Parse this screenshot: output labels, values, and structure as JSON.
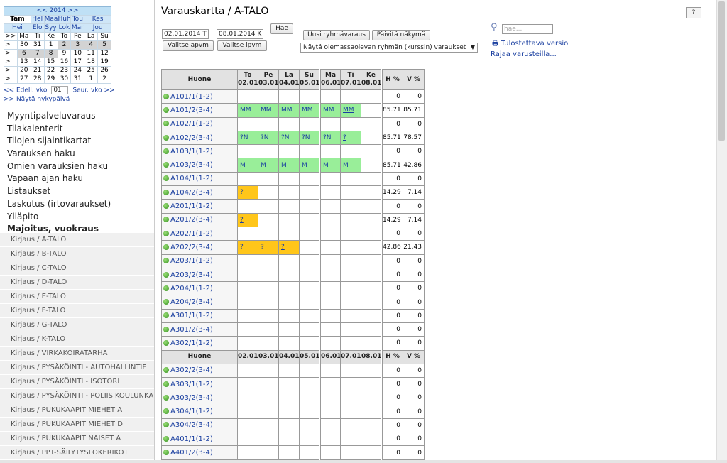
{
  "calendar": {
    "year_nav": "<< 2014 >>",
    "months_row1": [
      "Tam",
      "Hel",
      "Maa",
      "Huh",
      "Tou",
      "Kes"
    ],
    "months_row2": [
      "Hei",
      "Elo",
      "Syy",
      "Lok",
      "Mar",
      "Jou"
    ],
    "selected_month": "Tam",
    "day_header": [
      ">>",
      "Ma",
      "Ti",
      "Ke",
      "To",
      "Pe",
      "La",
      "Su"
    ],
    "weeks": [
      [
        ">",
        "30",
        "31",
        "1",
        "2",
        "3",
        "4",
        "5"
      ],
      [
        ">",
        "6",
        "7",
        "8",
        "9",
        "10",
        "11",
        "12"
      ],
      [
        ">",
        "13",
        "14",
        "15",
        "16",
        "17",
        "18",
        "19"
      ],
      [
        ">",
        "20",
        "21",
        "22",
        "23",
        "24",
        "25",
        "26"
      ],
      [
        ">",
        "27",
        "28",
        "29",
        "30",
        "31",
        "1",
        "2"
      ]
    ],
    "prev_week": "<< Edell. vko",
    "week_value": "01",
    "next_week": "Seur. vko >>",
    "show_today": ">> Näytä nykypäivä"
  },
  "menu": [
    "Myyntipalveluvaraus",
    "Tilakalenterit",
    "Tilojen sijaintikartat",
    "Varauksen haku",
    "Omien varauksien haku",
    "Vapaan ajan haku",
    "Listaukset",
    "Laskutus (irtovaraukset)",
    "Ylläpito",
    "Majoitus, vuokraus"
  ],
  "submenu": [
    "Kirjaus / A-TALO",
    "Kirjaus / B-TALO",
    "Kirjaus / C-TALO",
    "Kirjaus / D-TALO",
    "Kirjaus / E-TALO",
    "Kirjaus / F-TALO",
    "Kirjaus / G-TALO",
    "Kirjaus / K-TALO",
    "Kirjaus / VIRKAKOIRATARHA",
    "Kirjaus / PYSÄKÖINTI - AUTOHALLINTIE",
    "Kirjaus / PYSÄKÖINTI - ISOTORI",
    "Kirjaus / PYSÄKÖINTI - POLIISIKOULUNKATU",
    "Kirjaus / PUKUKAAPIT MIEHET A",
    "Kirjaus / PUKUKAAPIT MIEHET D",
    "Kirjaus / PUKUKAAPIT NAISET A",
    "Kirjaus / PPT-SÄILYTYSLOKERIKOT"
  ],
  "main": {
    "title": "Varauskartta / A-TALO",
    "help": "?",
    "start_date": "02.01.2014 T",
    "end_date": "08.01.2014 K",
    "fetch": "Hae",
    "choose_start": "Valitse apvm",
    "choose_end": "Valitse lpvm",
    "new_group": "Uusi ryhmävaraus",
    "refresh": "Päivitä näkymä",
    "group_select": "Näytä olemassaolevan ryhmän (kurssin) varaukset",
    "search_placeholder": "hae...",
    "print_link": "Tulostettava versio",
    "filter_link": "Rajaa varusteilla..."
  },
  "grid": {
    "room_header": "Huone",
    "day_names": [
      "To",
      "Pe",
      "La",
      "Su",
      "Ma",
      "Ti",
      "Ke"
    ],
    "dates": [
      "02.01",
      "03.01",
      "04.01",
      "05.01",
      "06.01",
      "07.01",
      "08.01"
    ],
    "h_pct": "H %",
    "v_pct": "V %",
    "rows": [
      {
        "room": "A101/1(1-2)",
        "cells": [
          "",
          "",
          "",
          "",
          "",
          "",
          ""
        ],
        "h": "0",
        "v": "0"
      },
      {
        "room": "A101/2(3-4)",
        "cells": [
          "MM",
          "MM",
          "MM",
          "MM",
          "MM",
          "MM",
          ""
        ],
        "h": "85.71",
        "v": "85.71"
      },
      {
        "room": "A102/1(1-2)",
        "cells": [
          "",
          "",
          "",
          "",
          "",
          "",
          ""
        ],
        "h": "0",
        "v": "0"
      },
      {
        "room": "A102/2(3-4)",
        "cells": [
          "?N",
          "?N",
          "?N",
          "?N",
          "?N",
          "?",
          ""
        ],
        "h": "85.71",
        "v": "78.57"
      },
      {
        "room": "A103/1(1-2)",
        "cells": [
          "",
          "",
          "",
          "",
          "",
          "",
          ""
        ],
        "h": "0",
        "v": "0"
      },
      {
        "room": "A103/2(3-4)",
        "cells": [
          "M",
          "M",
          "M",
          "M",
          "M",
          "M",
          ""
        ],
        "h": "85.71",
        "v": "42.86"
      },
      {
        "room": "A104/1(1-2)",
        "cells": [
          "",
          "",
          "",
          "",
          "",
          "",
          ""
        ],
        "h": "0",
        "v": "0"
      },
      {
        "room": "A104/2(3-4)",
        "cells": [
          "?",
          "",
          "",
          "",
          "",
          "",
          ""
        ],
        "h": "14.29",
        "v": "7.14"
      },
      {
        "room": "A201/1(1-2)",
        "cells": [
          "",
          "",
          "",
          "",
          "",
          "",
          ""
        ],
        "h": "0",
        "v": "0"
      },
      {
        "room": "A201/2(3-4)",
        "cells": [
          "?",
          "",
          "",
          "",
          "",
          "",
          ""
        ],
        "h": "14.29",
        "v": "7.14"
      },
      {
        "room": "A202/1(1-2)",
        "cells": [
          "",
          "",
          "",
          "",
          "",
          "",
          ""
        ],
        "h": "0",
        "v": "0"
      },
      {
        "room": "A202/2(3-4)",
        "cells": [
          "?",
          "?",
          "?",
          "",
          "",
          "",
          ""
        ],
        "h": "42.86",
        "v": "21.43"
      },
      {
        "room": "A203/1(1-2)",
        "cells": [
          "",
          "",
          "",
          "",
          "",
          "",
          ""
        ],
        "h": "0",
        "v": "0"
      },
      {
        "room": "A203/2(3-4)",
        "cells": [
          "",
          "",
          "",
          "",
          "",
          "",
          ""
        ],
        "h": "0",
        "v": "0"
      },
      {
        "room": "A204/1(1-2)",
        "cells": [
          "",
          "",
          "",
          "",
          "",
          "",
          ""
        ],
        "h": "0",
        "v": "0"
      },
      {
        "room": "A204/2(3-4)",
        "cells": [
          "",
          "",
          "",
          "",
          "",
          "",
          ""
        ],
        "h": "0",
        "v": "0"
      },
      {
        "room": "A301/1(1-2)",
        "cells": [
          "",
          "",
          "",
          "",
          "",
          "",
          ""
        ],
        "h": "0",
        "v": "0"
      },
      {
        "room": "A301/2(3-4)",
        "cells": [
          "",
          "",
          "",
          "",
          "",
          "",
          ""
        ],
        "h": "0",
        "v": "0"
      },
      {
        "room": "A302/1(1-2)",
        "cells": [
          "",
          "",
          "",
          "",
          "",
          "",
          ""
        ],
        "h": "0",
        "v": "0"
      }
    ],
    "rows2": [
      {
        "room": "A302/2(3-4)",
        "cells": [
          "",
          "",
          "",
          "",
          "",
          "",
          ""
        ],
        "h": "0",
        "v": "0"
      },
      {
        "room": "A303/1(1-2)",
        "cells": [
          "",
          "",
          "",
          "",
          "",
          "",
          ""
        ],
        "h": "0",
        "v": "0"
      },
      {
        "room": "A303/2(3-4)",
        "cells": [
          "",
          "",
          "",
          "",
          "",
          "",
          ""
        ],
        "h": "0",
        "v": "0"
      },
      {
        "room": "A304/1(1-2)",
        "cells": [
          "",
          "",
          "",
          "",
          "",
          "",
          ""
        ],
        "h": "0",
        "v": "0"
      },
      {
        "room": "A304/2(3-4)",
        "cells": [
          "",
          "",
          "",
          "",
          "",
          "",
          ""
        ],
        "h": "0",
        "v": "0"
      },
      {
        "room": "A401/1(1-2)",
        "cells": [
          "",
          "",
          "",
          "",
          "",
          "",
          ""
        ],
        "h": "0",
        "v": "0"
      },
      {
        "room": "A401/2(3-4)",
        "cells": [
          "",
          "",
          "",
          "",
          "",
          "",
          ""
        ],
        "h": "0",
        "v": "0"
      }
    ],
    "colors": {
      "green": "#99ee99",
      "yellow": "#ffc61a"
    }
  }
}
